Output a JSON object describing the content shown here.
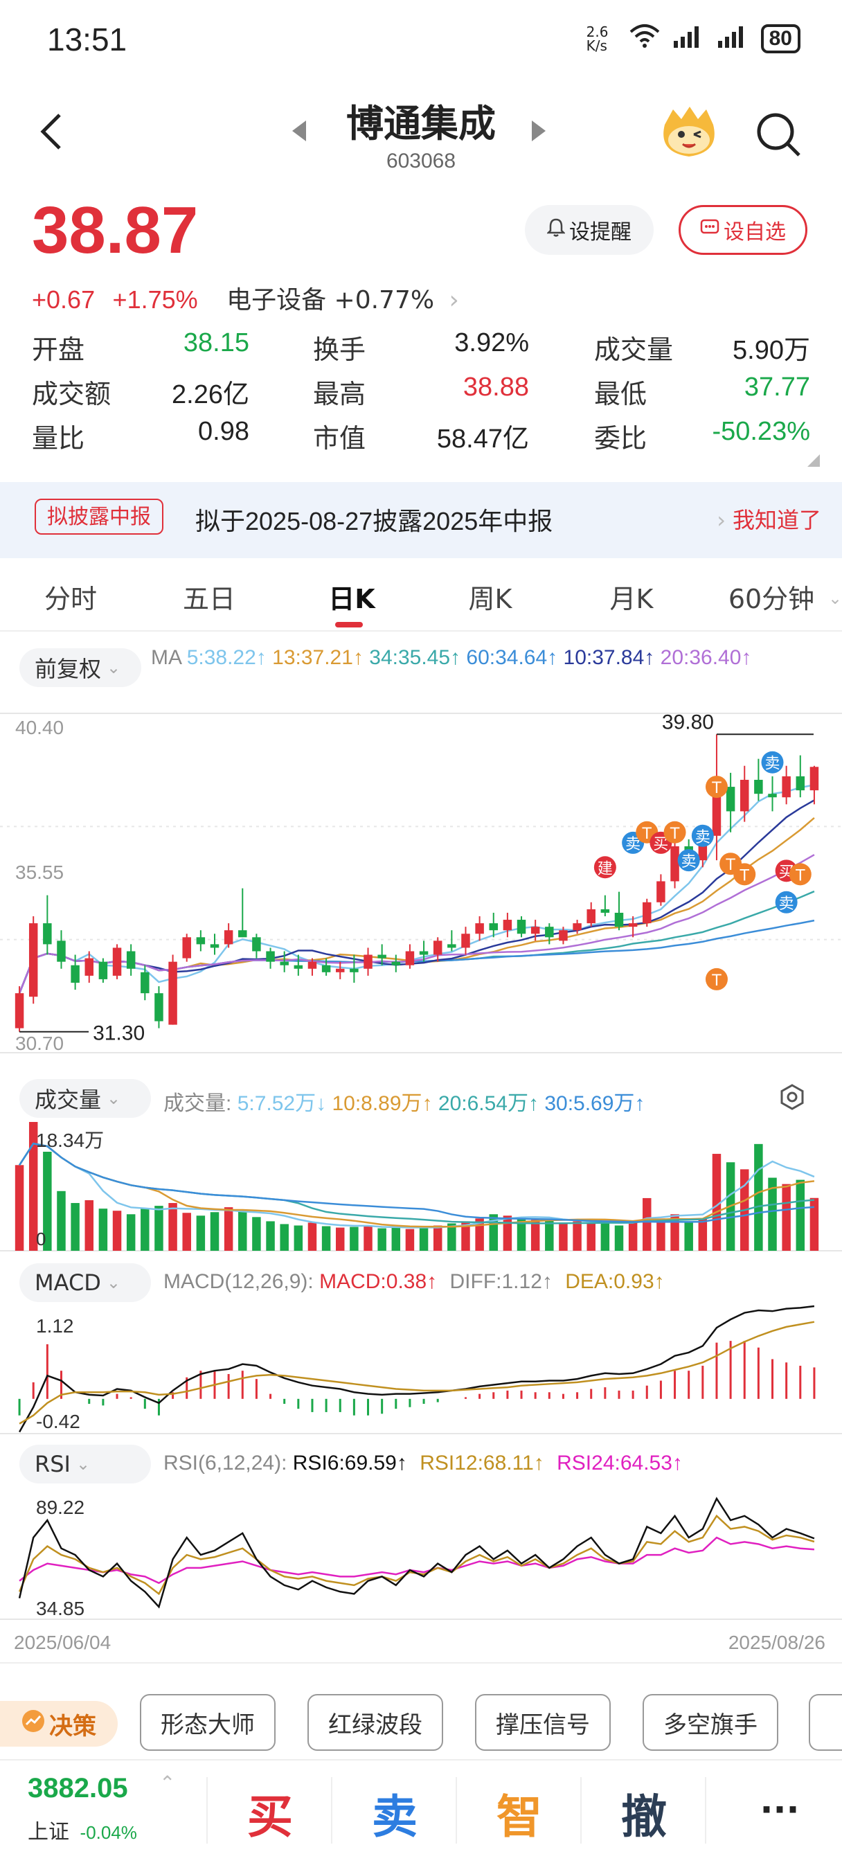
{
  "status": {
    "time": "13:51",
    "net_speed": "2.6 K/s",
    "battery": "80"
  },
  "header": {
    "title": "博通集成",
    "code": "603068"
  },
  "quote": {
    "price": "38.87",
    "change": "+0.67",
    "change_pct": "+1.75%",
    "sector": "电子设备 +0.77%",
    "alert_label": "设提醒",
    "watch_label": "设自选",
    "stats": [
      {
        "label": "开盘",
        "value": "38.15",
        "color": "green"
      },
      {
        "label": "换手",
        "value": "3.92%",
        "color": "black"
      },
      {
        "label": "成交量",
        "value": "5.90万",
        "color": "black"
      },
      {
        "label": "成交额",
        "value": "2.26亿",
        "color": "black"
      },
      {
        "label": "最高",
        "value": "38.88",
        "color": "red"
      },
      {
        "label": "最低",
        "value": "37.77",
        "color": "green"
      },
      {
        "label": "量比",
        "value": "0.98",
        "color": "black"
      },
      {
        "label": "市值",
        "value": "58.47亿",
        "color": "black"
      },
      {
        "label": "委比",
        "value": "-50.23%",
        "color": "green"
      }
    ]
  },
  "banner": {
    "tag": "拟披露中报",
    "text": "拟于2025-08-27披露2025年中报",
    "link": "我知道了"
  },
  "tabs": [
    "分时",
    "五日",
    "日K",
    "周K",
    "月K",
    "60分钟"
  ],
  "active_tab": "日K",
  "ma": {
    "adjust": "前复权",
    "prefix": "MA",
    "items": [
      "5:38.22↑",
      "13:37.21↑",
      "34:35.45↑",
      "60:34.64↑",
      "10:37.84↑",
      "20:36.40↑"
    ]
  },
  "volume": {
    "label": "成交量",
    "prefix": "成交量:",
    "items": [
      "5:7.52万↓",
      "10:8.89万↑",
      "20:6.54万↑",
      "30:5.69万↑"
    ],
    "max_label": "18.34万",
    "zero_label": "0"
  },
  "macd": {
    "label": "MACD",
    "params": "MACD(12,26,9):",
    "items": [
      "MACD:0.38↑",
      "DIFF:1.12↑",
      "DEA:0.93↑"
    ],
    "top": "1.12",
    "bottom": "-0.42"
  },
  "rsi": {
    "label": "RSI",
    "params": "RSI(6,12,24):",
    "items": [
      "RSI6:69.59↑",
      "RSI12:68.11↑",
      "RSI24:64.53↑"
    ],
    "top": "89.22",
    "bottom": "34.85"
  },
  "dates": {
    "start": "2025/06/04",
    "end": "2025/08/26"
  },
  "tools": {
    "decision": "决策",
    "buttons": [
      "形态大师",
      "红绿波段",
      "撑压信号",
      "多空旗手"
    ]
  },
  "bottom": {
    "index_value": "3882.05",
    "index_name": "上证",
    "index_change": "-0.04%",
    "buy": "买",
    "sell": "卖",
    "smart": "智",
    "cancel": "撤",
    "more": "···"
  },
  "chart_data": {
    "type": "candlestick",
    "ylim": [
      30.7,
      40.4
    ],
    "y_ticks": [
      "40.40",
      "35.55",
      "30.70"
    ],
    "max_label": "39.80",
    "min_label": "31.30",
    "candles": [
      [
        31.4,
        32.6,
        31.3,
        32.4
      ],
      [
        32.3,
        34.6,
        32.1,
        34.4
      ],
      [
        34.4,
        35.2,
        33.5,
        33.8
      ],
      [
        33.9,
        34.2,
        33.1,
        33.3
      ],
      [
        33.2,
        33.5,
        32.5,
        32.7
      ],
      [
        32.9,
        33.6,
        32.7,
        33.4
      ],
      [
        33.3,
        33.4,
        32.7,
        32.8
      ],
      [
        32.9,
        33.8,
        32.8,
        33.7
      ],
      [
        33.6,
        33.8,
        32.9,
        33.1
      ],
      [
        33.0,
        33.2,
        32.2,
        32.4
      ],
      [
        32.4,
        32.6,
        31.4,
        31.6
      ],
      [
        31.5,
        33.5,
        31.5,
        33.3
      ],
      [
        33.4,
        34.1,
        33.3,
        34.0
      ],
      [
        34.0,
        34.2,
        33.6,
        33.8
      ],
      [
        33.8,
        34.1,
        33.5,
        33.7
      ],
      [
        33.8,
        34.4,
        33.7,
        34.2
      ],
      [
        34.2,
        35.4,
        34.0,
        34.0
      ],
      [
        34.0,
        34.1,
        33.4,
        33.6
      ],
      [
        33.6,
        33.7,
        33.1,
        33.3
      ],
      [
        33.3,
        33.6,
        33.0,
        33.2
      ],
      [
        33.2,
        33.5,
        32.9,
        33.1
      ],
      [
        33.1,
        33.4,
        32.9,
        33.3
      ],
      [
        33.2,
        33.4,
        32.9,
        33.0
      ],
      [
        33.0,
        33.3,
        32.8,
        33.1
      ],
      [
        33.1,
        33.5,
        32.7,
        33.0
      ],
      [
        33.1,
        33.7,
        32.9,
        33.5
      ],
      [
        33.5,
        33.8,
        33.2,
        33.4
      ],
      [
        33.3,
        33.5,
        33.0,
        33.2
      ],
      [
        33.2,
        33.8,
        33.1,
        33.6
      ],
      [
        33.6,
        33.9,
        33.3,
        33.5
      ],
      [
        33.5,
        34.0,
        33.3,
        33.9
      ],
      [
        33.8,
        34.2,
        33.6,
        33.7
      ],
      [
        33.7,
        34.3,
        33.5,
        34.1
      ],
      [
        34.1,
        34.6,
        33.9,
        34.4
      ],
      [
        34.4,
        34.7,
        34.0,
        34.2
      ],
      [
        34.2,
        34.7,
        34.0,
        34.5
      ],
      [
        34.5,
        34.6,
        34.0,
        34.1
      ],
      [
        34.1,
        34.5,
        33.9,
        34.3
      ],
      [
        34.3,
        34.4,
        33.8,
        34.0
      ],
      [
        33.9,
        34.3,
        33.8,
        34.2
      ],
      [
        34.2,
        34.5,
        34.1,
        34.4
      ],
      [
        34.4,
        35.0,
        34.3,
        34.8
      ],
      [
        34.8,
        35.2,
        34.6,
        34.7
      ],
      [
        34.7,
        35.3,
        34.2,
        34.3
      ],
      [
        34.3,
        34.6,
        34.0,
        34.4
      ],
      [
        34.4,
        35.1,
        34.3,
        35.0
      ],
      [
        35.0,
        35.8,
        34.9,
        35.6
      ],
      [
        35.6,
        36.9,
        35.4,
        36.6
      ],
      [
        36.6,
        36.8,
        35.9,
        36.1
      ],
      [
        36.2,
        37.1,
        36.0,
        36.9
      ],
      [
        36.9,
        39.8,
        36.2,
        38.3
      ],
      [
        38.3,
        38.7,
        37.0,
        37.6
      ],
      [
        37.6,
        38.9,
        37.3,
        38.5
      ],
      [
        38.5,
        39.1,
        37.9,
        38.1
      ],
      [
        38.1,
        38.6,
        37.6,
        38.0
      ],
      [
        38.0,
        38.9,
        37.8,
        38.6
      ],
      [
        38.6,
        39.2,
        38.0,
        38.2
      ],
      [
        38.2,
        38.9,
        37.8,
        38.87
      ]
    ],
    "ma_series": [
      {
        "name": "MA5",
        "color": "#7ec5ec"
      },
      {
        "name": "MA13",
        "color": "#d99a33"
      },
      {
        "name": "MA34",
        "color": "#3aa9a9"
      },
      {
        "name": "MA60",
        "color": "#3b8dd8"
      },
      {
        "name": "MA10",
        "color": "#2a3a9a"
      },
      {
        "name": "MA20",
        "color": "#b06fd6"
      }
    ],
    "volume_ylim": [
      0,
      18.34
    ],
    "volume": [
      12.2,
      18.34,
      14.1,
      8.5,
      6.8,
      7.2,
      6.0,
      5.7,
      5.2,
      6.1,
      6.4,
      6.8,
      5.4,
      5.0,
      5.5,
      6.2,
      5.9,
      4.8,
      4.2,
      3.8,
      3.6,
      4.0,
      3.5,
      3.3,
      3.4,
      3.6,
      3.2,
      3.3,
      3.1,
      3.4,
      3.6,
      3.9,
      4.2,
      4.6,
      5.2,
      5.0,
      4.8,
      4.4,
      4.3,
      3.9,
      4.2,
      4.0,
      4.1,
      3.6,
      4.0,
      7.5,
      4.6,
      5.2,
      4.0,
      4.5,
      13.8,
      12.6,
      11.6,
      15.2,
      10.4,
      9.5,
      10.1,
      7.52
    ],
    "macd": {
      "ylim": [
        -0.42,
        1.12
      ],
      "dif": [
        -0.4,
        -0.1,
        0.28,
        0.22,
        0.08,
        0.05,
        0.04,
        0.12,
        0.1,
        0.02,
        -0.05,
        0.1,
        0.22,
        0.3,
        0.34,
        0.36,
        0.42,
        0.4,
        0.32,
        0.25,
        0.2,
        0.16,
        0.14,
        0.12,
        0.08,
        0.06,
        0.05,
        0.06,
        0.06,
        0.07,
        0.08,
        0.1,
        0.12,
        0.15,
        0.17,
        0.19,
        0.21,
        0.21,
        0.22,
        0.22,
        0.24,
        0.28,
        0.31,
        0.3,
        0.31,
        0.36,
        0.42,
        0.52,
        0.56,
        0.64,
        0.86,
        0.96,
        1.04,
        1.07,
        1.06,
        1.09,
        1.1,
        1.12
      ],
      "dea": [
        -0.3,
        -0.2,
        -0.05,
        0.05,
        0.08,
        0.08,
        0.08,
        0.09,
        0.09,
        0.08,
        0.05,
        0.06,
        0.09,
        0.13,
        0.17,
        0.21,
        0.25,
        0.28,
        0.29,
        0.28,
        0.26,
        0.24,
        0.22,
        0.2,
        0.18,
        0.16,
        0.14,
        0.12,
        0.11,
        0.1,
        0.1,
        0.1,
        0.11,
        0.12,
        0.13,
        0.14,
        0.16,
        0.17,
        0.18,
        0.19,
        0.2,
        0.22,
        0.24,
        0.25,
        0.26,
        0.28,
        0.31,
        0.35,
        0.39,
        0.44,
        0.52,
        0.61,
        0.69,
        0.76,
        0.82,
        0.87,
        0.9,
        0.93
      ]
    },
    "rsi": {
      "ylim": [
        34.85,
        89.22
      ],
      "rsi6": [
        42,
        70,
        78,
        65,
        62,
        55,
        52,
        58,
        50,
        45,
        38,
        60,
        70,
        62,
        64,
        68,
        72,
        60,
        52,
        48,
        46,
        50,
        47,
        45,
        44,
        50,
        52,
        48,
        55,
        52,
        58,
        54,
        62,
        66,
        60,
        64,
        58,
        62,
        56,
        60,
        66,
        70,
        62,
        58,
        60,
        75,
        72,
        80,
        70,
        74,
        88,
        78,
        80,
        76,
        70,
        74,
        72,
        69.59
      ],
      "rsi12": [
        45,
        60,
        66,
        62,
        60,
        56,
        54,
        56,
        52,
        49,
        44,
        56,
        62,
        60,
        61,
        63,
        65,
        60,
        55,
        52,
        51,
        52,
        50,
        49,
        48,
        51,
        52,
        50,
        54,
        53,
        56,
        54,
        59,
        62,
        59,
        61,
        57,
        60,
        56,
        58,
        62,
        65,
        60,
        58,
        59,
        68,
        67,
        73,
        68,
        70,
        80,
        74,
        75,
        73,
        69,
        71,
        70,
        68.11
      ],
      "rsi24": [
        50,
        55,
        58,
        57,
        56,
        55,
        54,
        55,
        53,
        52,
        49,
        53,
        56,
        56,
        57,
        58,
        59,
        57,
        55,
        54,
        53,
        54,
        53,
        52,
        52,
        53,
        54,
        53,
        55,
        54,
        56,
        55,
        57,
        59,
        58,
        59,
        57,
        58,
        56,
        57,
        60,
        61,
        59,
        58,
        58,
        62,
        62,
        65,
        63,
        64,
        70,
        67,
        68,
        67,
        65,
        66,
        65,
        64.53
      ]
    }
  },
  "colors": {
    "up": "#e0303a",
    "down": "#1aa84a",
    "accent": "#e0303a"
  }
}
